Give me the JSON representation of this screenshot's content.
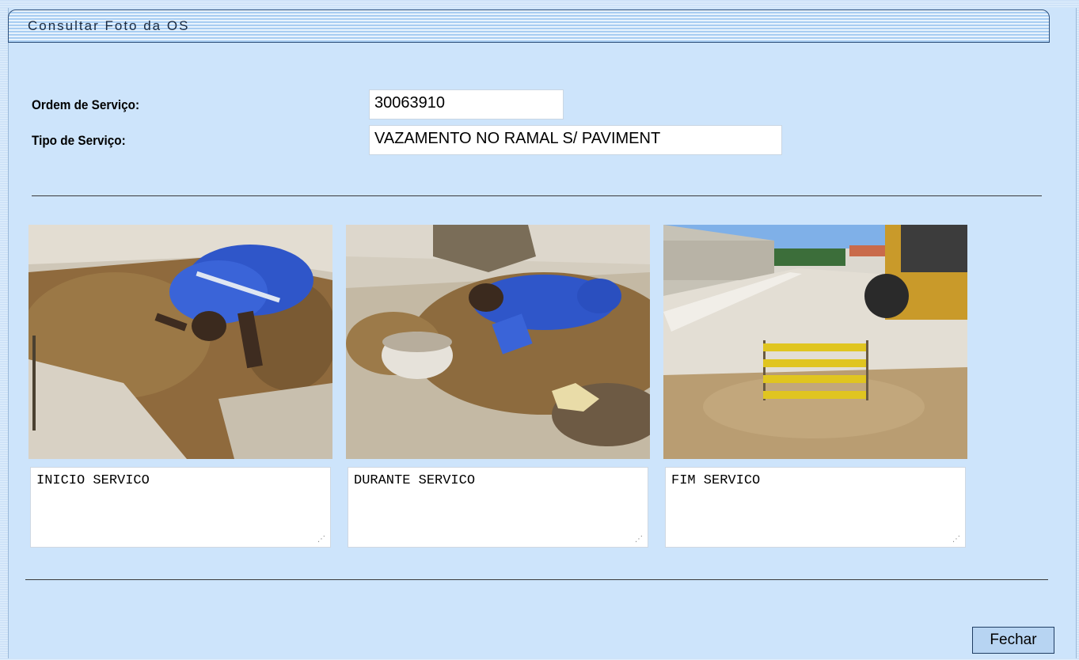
{
  "window": {
    "title": "Consultar Foto da OS"
  },
  "form": {
    "ordem_label": "Ordem de Serviço:",
    "ordem_value": "30063910",
    "tipo_label": "Tipo de Serviço:",
    "tipo_value": "VAZAMENTO NO RAMAL S/ PAVIMENT"
  },
  "photos": [
    {
      "caption": "INICIO SERVICO"
    },
    {
      "caption": "DURANTE SERVICO"
    },
    {
      "caption": "FIM SERVICO"
    }
  ],
  "buttons": {
    "close_label": "Fechar"
  }
}
